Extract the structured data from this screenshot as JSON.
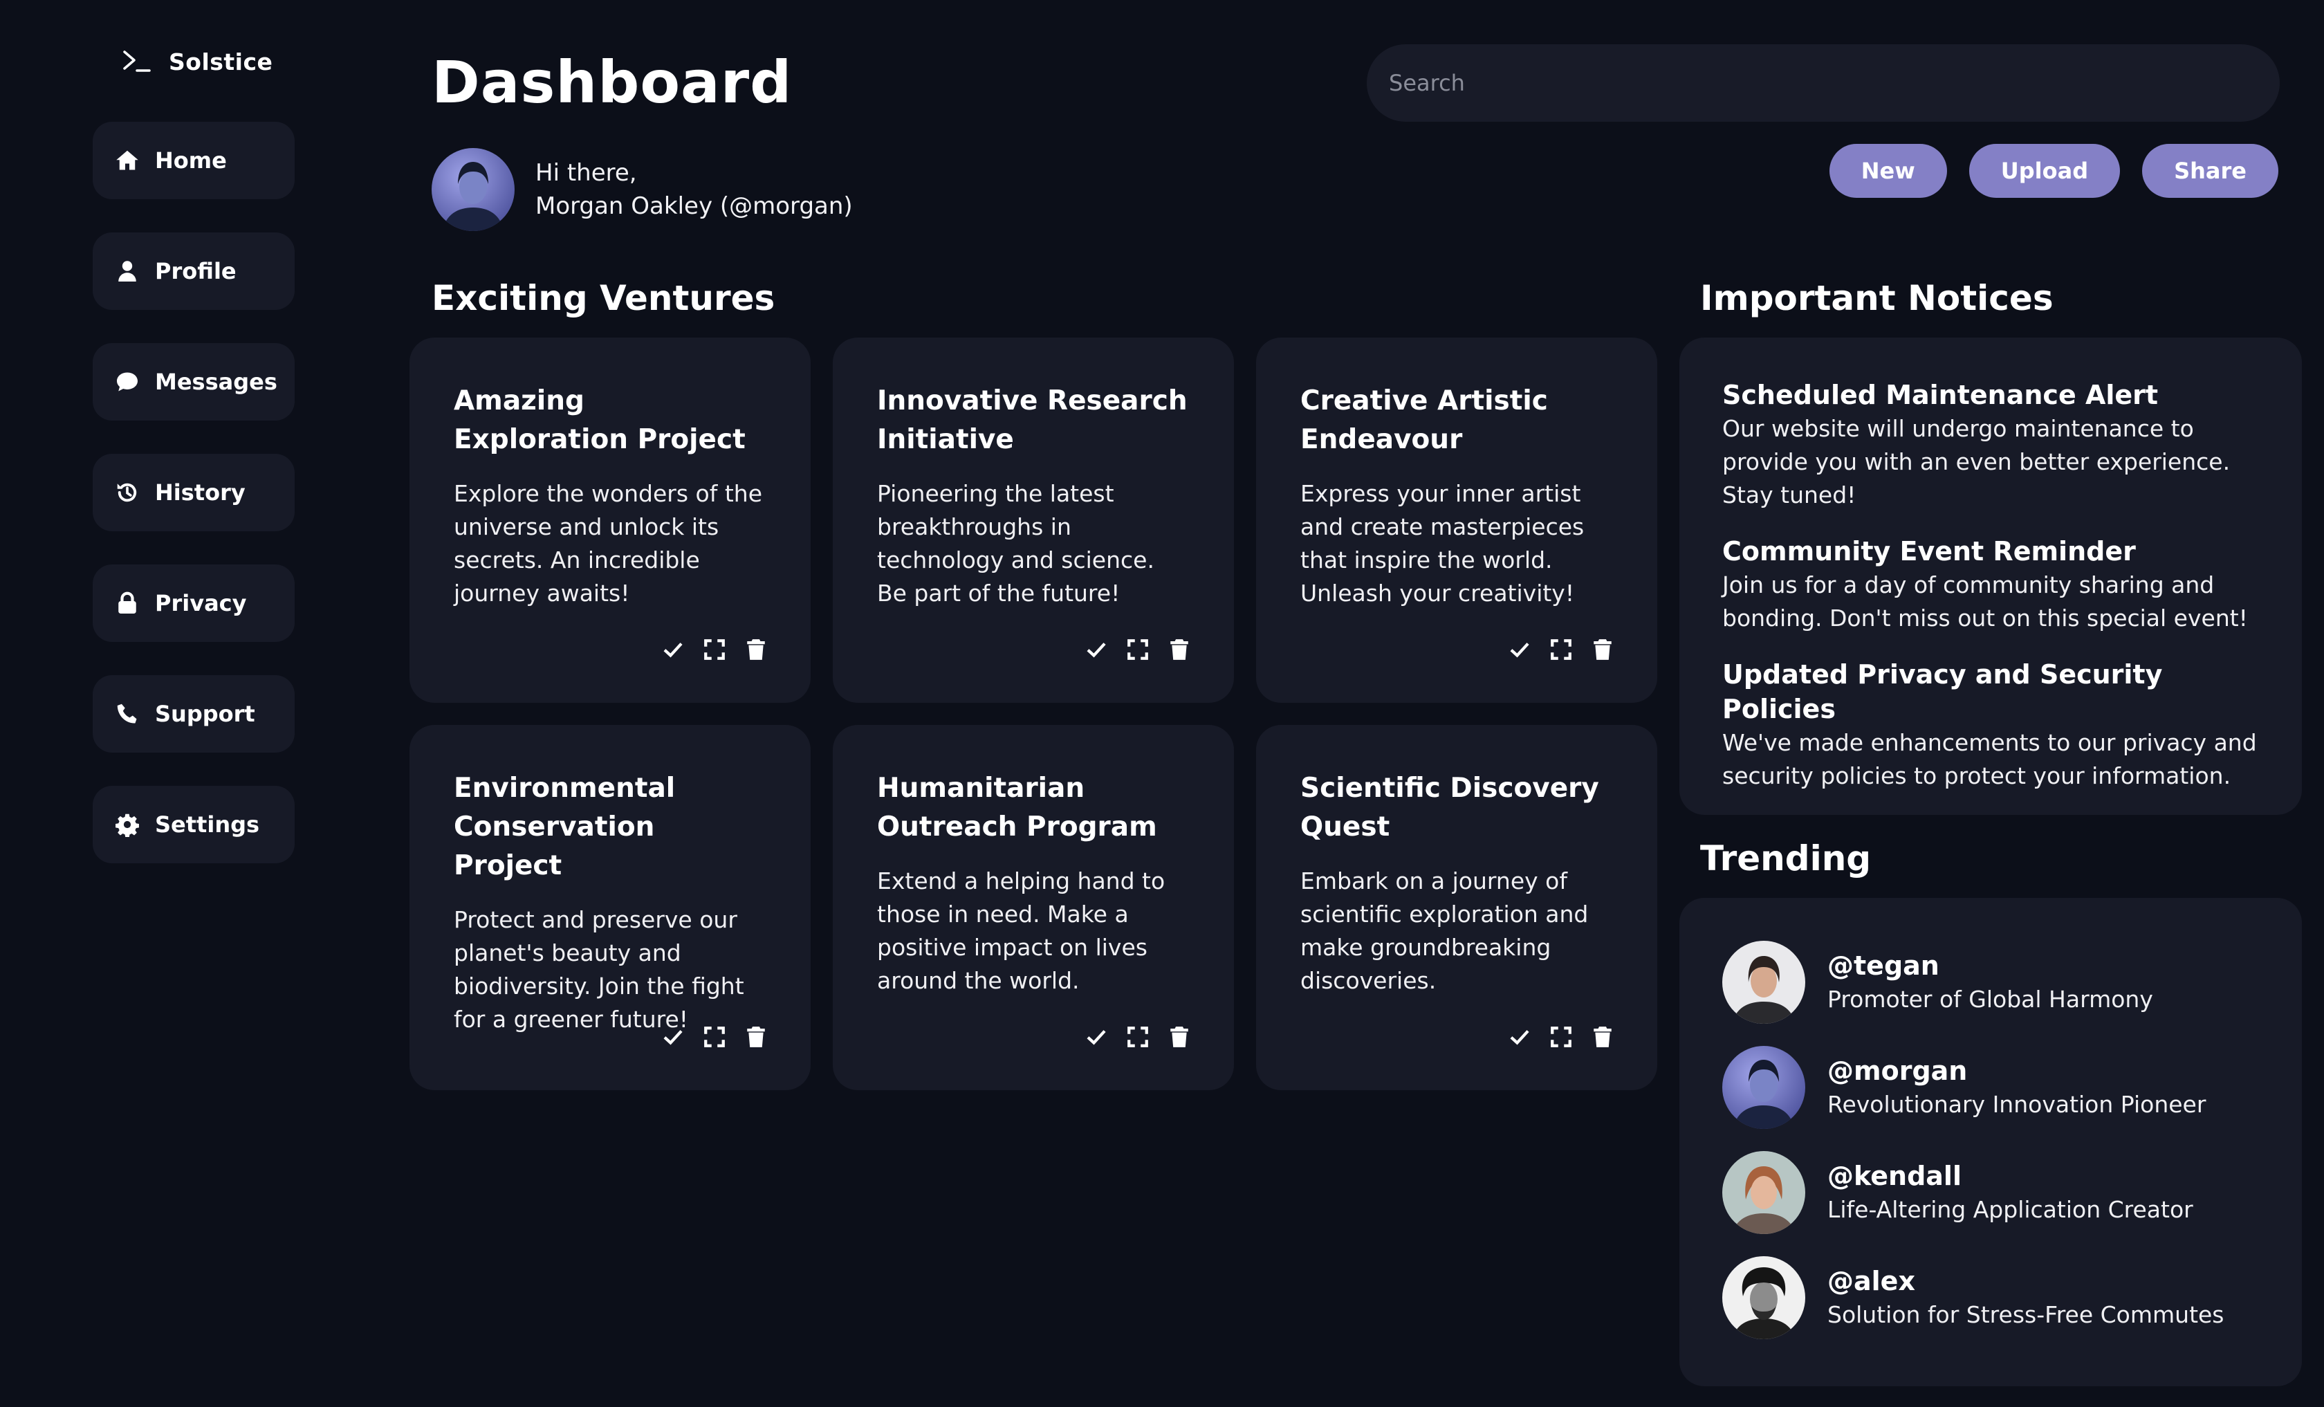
{
  "app": {
    "name": "Solstice"
  },
  "sidebar": {
    "items": [
      {
        "label": "Home",
        "icon": "home-icon"
      },
      {
        "label": "Profile",
        "icon": "user-icon"
      },
      {
        "label": "Messages",
        "icon": "chat-icon"
      },
      {
        "label": "History",
        "icon": "history-icon"
      },
      {
        "label": "Privacy",
        "icon": "lock-icon"
      },
      {
        "label": "Support",
        "icon": "phone-icon"
      },
      {
        "label": "Settings",
        "icon": "gear-icon"
      }
    ]
  },
  "header": {
    "title": "Dashboard",
    "search_placeholder": "Search",
    "greeting_line1": "Hi there,",
    "greeting_line2": "Morgan Oakley (@morgan)",
    "buttons": {
      "new": "New",
      "upload": "Upload",
      "share": "Share"
    }
  },
  "colors": {
    "background": "#0c0f19",
    "card": "#171a27",
    "accent": "#8480c6"
  },
  "ventures": {
    "title": "Exciting Ventures",
    "cards": [
      {
        "title": "Amazing Exploration Project",
        "description": "Explore the wonders of the universe and unlock its secrets. An incredible journey awaits!"
      },
      {
        "title": "Innovative Research Initiative",
        "description": "Pioneering the latest breakthroughs in technology and science. Be part of the future!"
      },
      {
        "title": "Creative Artistic Endeavour",
        "description": "Express your inner artist and create masterpieces that inspire the world. Unleash your creativity!"
      },
      {
        "title": "Environmental Conservation Project",
        "description": "Protect and preserve our planet's beauty and biodiversity. Join the fight for a greener future!"
      },
      {
        "title": "Humanitarian Outreach Program",
        "description": "Extend a helping hand to those in need. Make a positive impact on lives around the world."
      },
      {
        "title": "Scientific Discovery Quest",
        "description": "Embark on a journey of scientific exploration and make groundbreaking discoveries."
      }
    ],
    "card_action_icons": [
      "check-icon",
      "expand-icon",
      "trash-icon"
    ]
  },
  "notices": {
    "title": "Important Notices",
    "items": [
      {
        "title": "Scheduled Maintenance Alert",
        "body": "Our website will undergo maintenance to provide you with an even better experience. Stay tuned!"
      },
      {
        "title": "Community Event Reminder",
        "body": "Join us for a day of community sharing and bonding. Don't miss out on this special event!"
      },
      {
        "title": "Updated Privacy and Security Policies",
        "body": "We've made enhancements to our privacy and security policies to protect your information."
      }
    ]
  },
  "trending": {
    "title": "Trending",
    "items": [
      {
        "handle": "@tegan",
        "description": "Promoter of Global Harmony"
      },
      {
        "handle": "@morgan",
        "description": "Revolutionary Innovation Pioneer"
      },
      {
        "handle": "@kendall",
        "description": "Life-Altering Application Creator"
      },
      {
        "handle": "@alex",
        "description": "Solution for Stress-Free Commutes"
      }
    ]
  }
}
